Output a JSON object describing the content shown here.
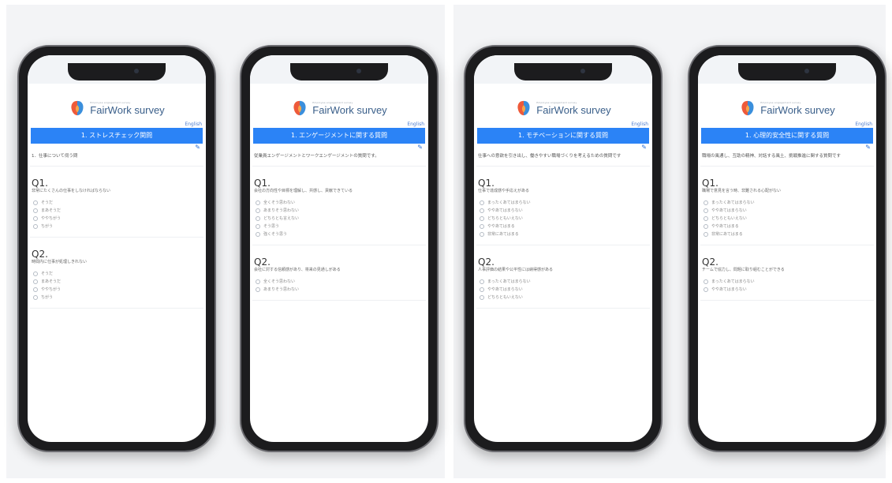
{
  "brand": {
    "name": "FairWork survey",
    "tagline": "Employee engagement survey"
  },
  "lang_label": "English",
  "screens": [
    {
      "section_title": "1. ストレスチェック関問",
      "description": "1．仕事について伺う問",
      "questions": [
        {
          "number": "Q1.",
          "text": "非常にたくさんの仕事をしなければならない",
          "options": [
            "そうだ",
            "まあそうだ",
            "ややちがう",
            "ちがう"
          ]
        },
        {
          "number": "Q2.",
          "text": "時間内に仕事が処理しきれない",
          "options": [
            "そうだ",
            "まあそうだ",
            "ややちがう",
            "ちがう"
          ]
        }
      ]
    },
    {
      "section_title": "1. エンゲージメントに関する質問",
      "description": "従業員エンゲージメントとワークエンゲージメントの質問です。",
      "questions": [
        {
          "number": "Q1.",
          "text": "会社の方向性や目標を理解し、共感し、貢献できている",
          "options": [
            "全くそう思わない",
            "あまりそう思わない",
            "どちらとも言えない",
            "そう思う",
            "強くそう思う"
          ]
        },
        {
          "number": "Q2.",
          "text": "会社に対する信頼感があり、将来の見通しがある",
          "options": [
            "全くそう思わない",
            "あまりそう思わない"
          ]
        }
      ]
    },
    {
      "section_title": "1. モチベーションに関する質問",
      "description": "仕事への意欲を引き出し、働きやすい職場づくりを考えるための質問です",
      "questions": [
        {
          "number": "Q1.",
          "text": "仕事で達成感や手応えがある",
          "options": [
            "まったくあてはまらない",
            "ややあてはまらない",
            "どちらともいえない",
            "ややあてはまる",
            "非常にあてはまる"
          ]
        },
        {
          "number": "Q2.",
          "text": "人事評価の結果や公平性には納得感がある",
          "options": [
            "まったくあてはまらない",
            "ややあてはまらない",
            "どちらともいえない"
          ]
        }
      ]
    },
    {
      "section_title": "1. 心理的安全性に関する質問",
      "description": "職場の風通し、互助の精神、対話する風土、挑戦推進に関する質問です",
      "questions": [
        {
          "number": "Q1.",
          "text": "職場で意見を言う時、非難される心配がない",
          "options": [
            "まったくあてはまらない",
            "ややあてはまらない",
            "どちらともいえない",
            "ややあてはまる",
            "非常にあてはまる"
          ]
        },
        {
          "number": "Q2.",
          "text": "チームで協力し、問題に取り組むことができる",
          "options": [
            "まったくあてはまらない",
            "ややあてはまらない"
          ]
        }
      ]
    }
  ]
}
